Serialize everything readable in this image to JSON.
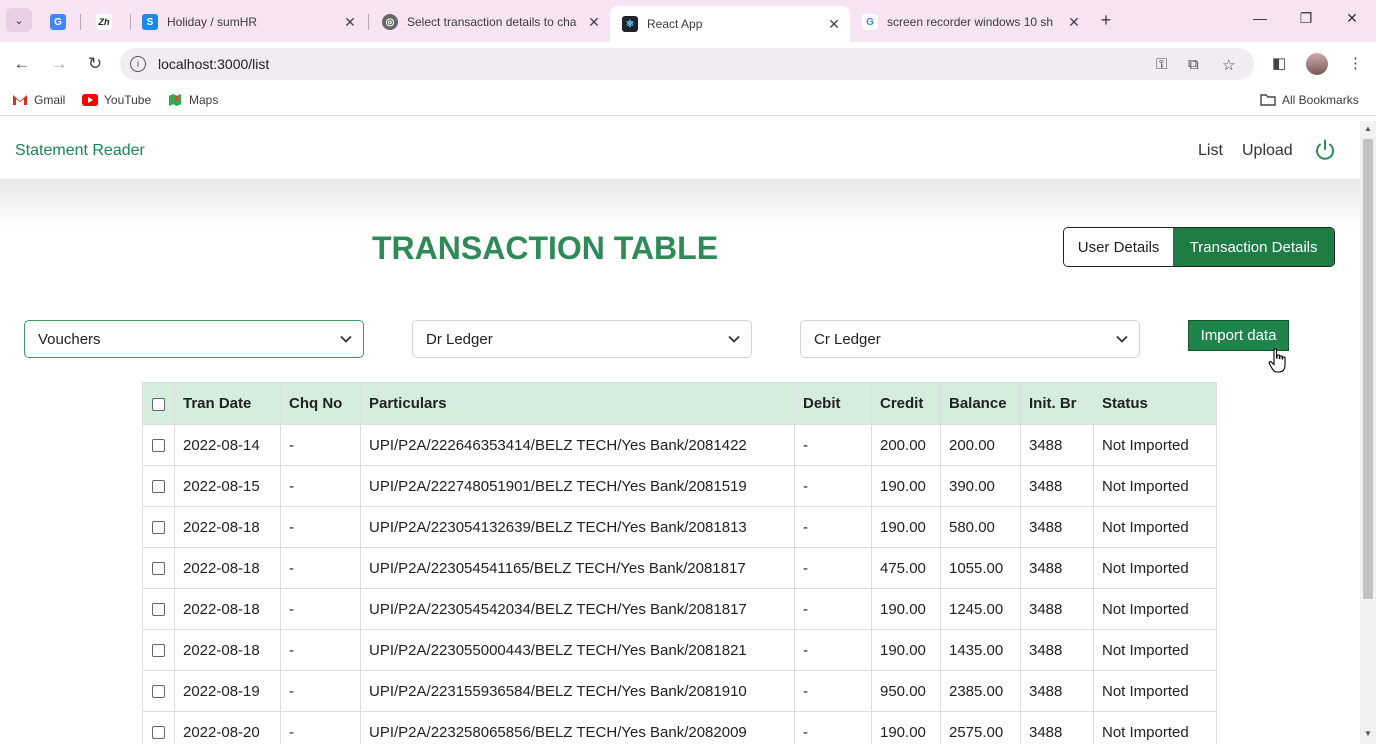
{
  "browser": {
    "tabs": [
      {
        "title": "",
        "favicon": "translate-icon",
        "color": "#4285f4"
      },
      {
        "title": "",
        "favicon": "zoho-icon",
        "color": "#333333"
      },
      {
        "title": "Holiday / sumHR",
        "favicon": "sumhr-icon",
        "color": "#1e88e5"
      },
      {
        "title": "Select transaction details to cha",
        "favicon": "globe-icon",
        "color": "#555555"
      },
      {
        "title": "React App",
        "favicon": "react-icon",
        "color": "#222222"
      },
      {
        "title": "screen recorder windows 10 sh",
        "favicon": "google-icon",
        "color": "#4285f4"
      }
    ],
    "url": "localhost:3000/list",
    "bookmarks": [
      {
        "label": "Gmail",
        "icon": "gmail-icon"
      },
      {
        "label": "YouTube",
        "icon": "youtube-icon"
      },
      {
        "label": "Maps",
        "icon": "maps-icon"
      }
    ],
    "all_bookmarks": "All Bookmarks"
  },
  "app": {
    "brand": "Statement Reader",
    "nav": {
      "list": "List",
      "upload": "Upload"
    },
    "title": "TRANSACTION TABLE",
    "toggle": {
      "user": "User Details",
      "transaction": "Transaction Details"
    },
    "selects": {
      "vouchers": "Vouchers",
      "dr_ledger": "Dr Ledger",
      "cr_ledger": "Cr Ledger"
    },
    "import_button": "Import data",
    "accent": "#198754"
  },
  "table": {
    "headers": [
      "Tran Date",
      "Chq No",
      "Particulars",
      "Debit",
      "Credit",
      "Balance",
      "Init. Br",
      "Status"
    ],
    "rows": [
      [
        "2022-08-14",
        "-",
        "UPI/P2A/222646353414/BELZ TECH/Yes Bank/2081422",
        "-",
        "200.00",
        "200.00",
        "3488",
        "Not Imported"
      ],
      [
        "2022-08-15",
        "-",
        "UPI/P2A/222748051901/BELZ TECH/Yes Bank/2081519",
        "-",
        "190.00",
        "390.00",
        "3488",
        "Not Imported"
      ],
      [
        "2022-08-18",
        "-",
        "UPI/P2A/223054132639/BELZ TECH/Yes Bank/2081813",
        "-",
        "190.00",
        "580.00",
        "3488",
        "Not Imported"
      ],
      [
        "2022-08-18",
        "-",
        "UPI/P2A/223054541165/BELZ TECH/Yes Bank/2081817",
        "-",
        "475.00",
        "1055.00",
        "3488",
        "Not Imported"
      ],
      [
        "2022-08-18",
        "-",
        "UPI/P2A/223054542034/BELZ TECH/Yes Bank/2081817",
        "-",
        "190.00",
        "1245.00",
        "3488",
        "Not Imported"
      ],
      [
        "2022-08-18",
        "-",
        "UPI/P2A/223055000443/BELZ TECH/Yes Bank/2081821",
        "-",
        "190.00",
        "1435.00",
        "3488",
        "Not Imported"
      ],
      [
        "2022-08-19",
        "-",
        "UPI/P2A/223155936584/BELZ TECH/Yes Bank/2081910",
        "-",
        "950.00",
        "2385.00",
        "3488",
        "Not Imported"
      ],
      [
        "2022-08-20",
        "-",
        "UPI/P2A/223258065856/BELZ TECH/Yes Bank/2082009",
        "-",
        "190.00",
        "2575.00",
        "3488",
        "Not Imported"
      ]
    ]
  }
}
